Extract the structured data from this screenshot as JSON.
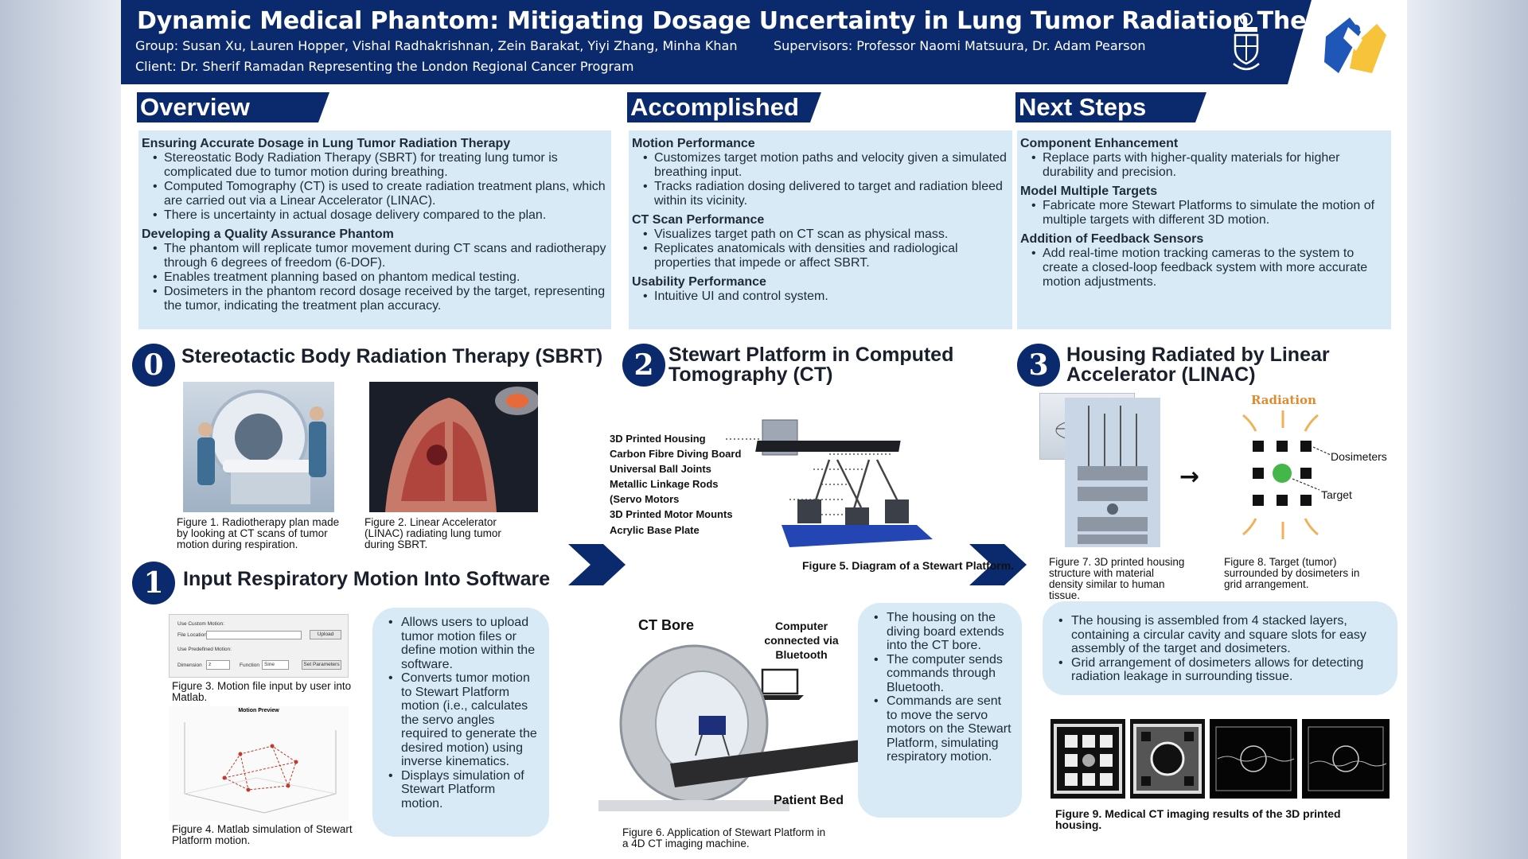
{
  "header": {
    "title": "Dynamic Medical Phantom: Mitigating Dosage Uncertainty in Lung Tumor Radiation Therapy",
    "group": "Group: Susan Xu, Lauren Hopper, Vishal Radhakrishnan, Zein Barakat, Yiyi Zhang, Minha Khan",
    "supervisors": "Supervisors: Professor Naomi Matsuura, Dr. Adam Pearson",
    "client": "Client: Dr. Sherif Ramadan Representing the London Regional Cancer Program"
  },
  "overview": {
    "heading": "Overview",
    "sub1": "Ensuring Accurate Dosage in Lung Tumor Radiation Therapy",
    "bullets1": [
      "Stereostatic Body Radiation Therapy (SBRT) for treating lung tumor is complicated due to tumor motion during breathing.",
      "Computed Tomography (CT) is used to create radiation treatment plans, which are carried out via a Linear Accelerator (LINAC).",
      "There is uncertainty in actual dosage delivery compared to the plan."
    ],
    "sub2": "Developing a Quality Assurance Phantom",
    "bullets2": [
      "The phantom will replicate tumor movement during CT scans and radiotherapy through 6 degrees of freedom (6-DOF).",
      "Enables treatment planning based on phantom medical testing.",
      "Dosimeters in the phantom record dosage received by the target, representing the tumor, indicating the treatment plan accuracy."
    ]
  },
  "accomplished": {
    "heading": "Accomplished",
    "sub1": "Motion Performance",
    "bullets1": [
      "Customizes target motion paths and velocity given a simulated breathing input.",
      "Tracks radiation dosing delivered to target and radiation bleed within its vicinity."
    ],
    "sub2": "CT Scan Performance",
    "bullets2": [
      "Visualizes target path on CT scan as physical mass.",
      "Replicates anatomicals with densities and radiological properties that impede or affect SBRT."
    ],
    "sub3": "Usability Performance",
    "bullets3": [
      "Intuitive UI and control system."
    ]
  },
  "next_steps": {
    "heading": "Next Steps",
    "sub1": "Component Enhancement",
    "bullets1": [
      "Replace parts with higher-quality materials for higher durability and precision."
    ],
    "sub2": "Model Multiple Targets",
    "bullets2": [
      "Fabricate more Stewart Platforms to simulate the motion of multiple targets with different 3D motion."
    ],
    "sub3": "Addition of Feedback Sensors",
    "bullets3": [
      "Add real-time motion tracking cameras to the system to create a closed-loop feedback system with more accurate motion adjustments."
    ]
  },
  "step0": {
    "num": "0",
    "title": "Stereotactic Body Radiation Therapy (SBRT)",
    "fig1": "Figure 1.  Radiotherapy plan made by looking at CT scans of tumor motion during respiration.",
    "fig2": "Figure 2. Linear Accelerator (LINAC) radiating lung tumor during SBRT."
  },
  "step1": {
    "num": "1",
    "title": "Input Respiratory Motion Into Software",
    "fig3": "Figure 3. Motion file input by user into Matlab.",
    "fig4": "Figure 4. Matlab simulation of Stewart Platform motion.",
    "bullets": [
      "Allows users to upload tumor motion files or define motion within the software.",
      "Converts tumor motion to Stewart Platform motion (i.e., calculates the servo angles required to generate the desired motion) using inverse kinematics.",
      "Displays simulation of Stewart Platform motion."
    ],
    "ui": {
      "custom_label": "Use Custom Motion:",
      "file_label": "File Location:",
      "upload": "Upload",
      "predef_label": "Use Predefined Motion:",
      "dimension": "Dimension",
      "dim_val": "z",
      "function": "Function",
      "fn_val": "Sine",
      "set_params": "Set Parameters",
      "plot_title": "Motion Preview"
    }
  },
  "step2": {
    "num": "2",
    "title": "Stewart Platform in Computed Tomography (CT)",
    "labels": [
      "3D Printed Housing",
      "Carbon Fibre Diving Board",
      "Universal Ball Joints",
      "Metallic Linkage Rods",
      "(Servo Motors",
      "3D Printed Motor Mounts",
      "Acrylic Base Plate"
    ],
    "fig5": "Figure 5. Diagram of a Stewart Platform.",
    "ct_bore": "CT Bore",
    "computer": "Computer connected via Bluetooth",
    "patient_bed": "Patient Bed",
    "fig6": "Figure 6.  Application of Stewart Platform in a 4D CT imaging machine.",
    "bullets": [
      "The housing on the diving board extends into the CT bore.",
      "The computer sends commands through Bluetooth.",
      "Commands are sent to move the servo motors on the Stewart Platform, simulating respiratory motion."
    ]
  },
  "step3": {
    "num": "3",
    "title": "Housing Radiated by Linear Accelerator (LINAC)",
    "radiation": "Radiation",
    "dosimeters": "Dosimeters",
    "target": "Target",
    "fig7": "Figure 7. 3D printed housing structure with material density similar to human tissue.",
    "fig8": "Figure 8. Target (tumor) surrounded by dosimeters in grid arrangement.",
    "bullets": [
      "The housing is assembled from 4 stacked layers, containing a circular cavity and square slots for easy assembly of the target and dosimeters.",
      "Grid arrangement of dosimeters allows for detecting radiation leakage in surrounding tissue."
    ],
    "fig9": "Figure 9.  Medical CT imaging results of the 3D printed housing."
  },
  "colors": {
    "navy": "#0b2a6d",
    "light_blue": "#d7eaf6",
    "accent_yellow": "#f6c33a"
  }
}
